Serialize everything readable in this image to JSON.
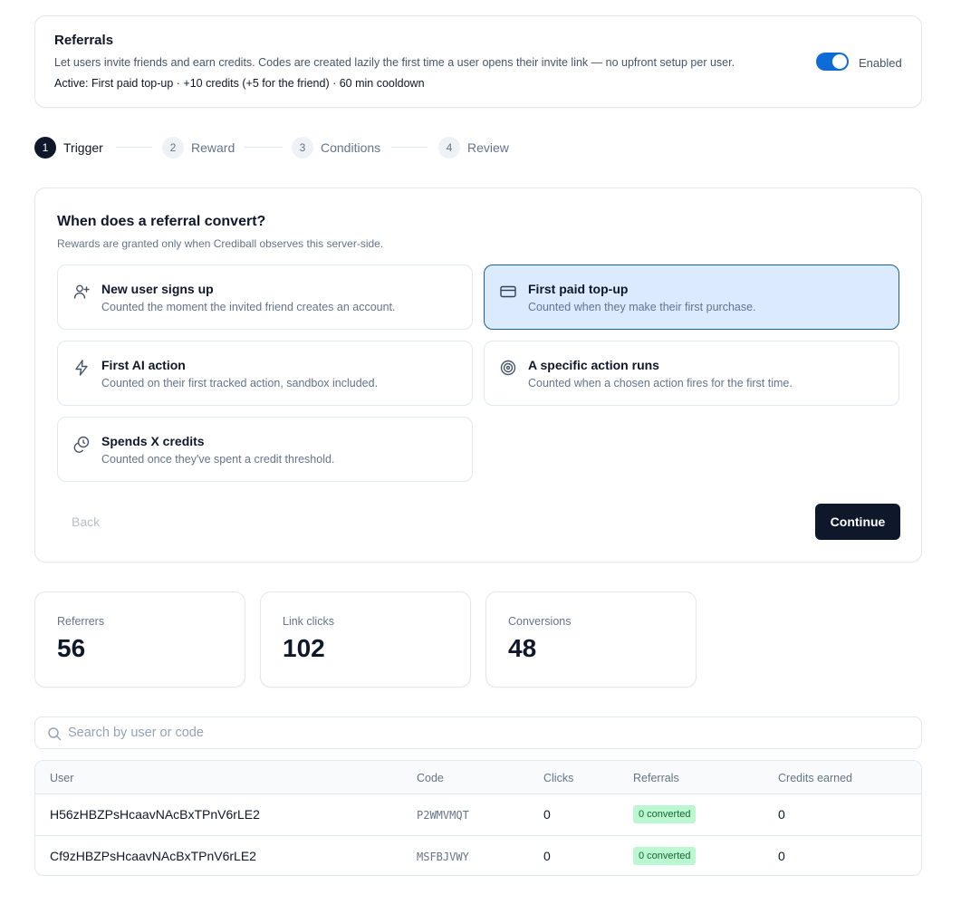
{
  "header": {
    "title": "Referrals",
    "description": "Let users invite friends and earn credits. Codes are created lazily the first time a user opens their invite link — no upfront setup per user.",
    "active_summary": "Active: First paid top-up · +10 credits (+5 for the friend) · 60 min cooldown",
    "toggle_label": "Enabled",
    "toggle_on": true,
    "accent": "#0f6bd6"
  },
  "steps": [
    {
      "num": "1",
      "label": "Trigger",
      "active": true
    },
    {
      "num": "2",
      "label": "Reward",
      "active": false
    },
    {
      "num": "3",
      "label": "Conditions",
      "active": false
    },
    {
      "num": "4",
      "label": "Review",
      "active": false
    }
  ],
  "trigger": {
    "question": "When does a referral convert?",
    "subtitle": "Rewards are granted only when Crediball observes this server-side.",
    "options": [
      {
        "icon": "user-plus-icon",
        "title": "New user signs up",
        "subtitle": "Counted the moment the invited friend creates an account.",
        "selected": false
      },
      {
        "icon": "credit-card-icon",
        "title": "First paid top-up",
        "subtitle": "Counted when they make their first purchase.",
        "selected": true
      },
      {
        "icon": "lightning-icon",
        "title": "First AI action",
        "subtitle": "Counted on their first tracked action, sandbox included.",
        "selected": false
      },
      {
        "icon": "target-icon",
        "title": "A specific action runs",
        "subtitle": "Counted when a chosen action fires for the first time.",
        "selected": false
      },
      {
        "icon": "coins-icon",
        "title": "Spends X credits",
        "subtitle": "Counted once they've spent a credit threshold.",
        "selected": false
      }
    ],
    "back_label": "Back",
    "continue_label": "Continue"
  },
  "stats": [
    {
      "label": "Referrers",
      "value": "56"
    },
    {
      "label": "Link clicks",
      "value": "102"
    },
    {
      "label": "Conversions",
      "value": "48"
    }
  ],
  "search": {
    "placeholder": "Search by user or code",
    "value": ""
  },
  "table": {
    "columns": [
      "User",
      "Code",
      "Clicks",
      "Referrals",
      "Credits earned"
    ],
    "rows": [
      {
        "user": "H56zHBZPsHcaavNAcBxTPnV6rLE2",
        "code": "P2WMVMQT",
        "clicks": "0",
        "referrals": "0 converted",
        "credits": "0"
      },
      {
        "user": "Cf9zHBZPsHcaavNAcBxTPnV6rLE2",
        "code": "MSFBJVWY",
        "clicks": "0",
        "referrals": "0 converted",
        "credits": "0"
      }
    ]
  }
}
